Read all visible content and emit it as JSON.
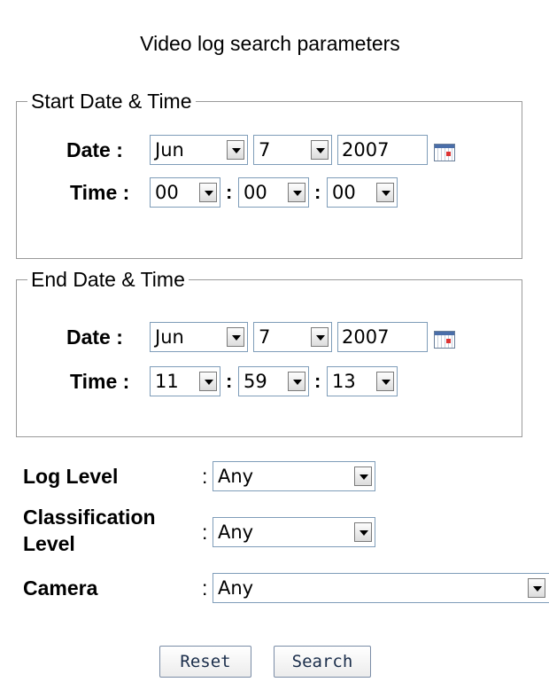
{
  "title": "Video log search parameters",
  "start": {
    "legend": "Start Date & Time",
    "date_label": "Date :",
    "time_label": "Time :",
    "month": "Jun",
    "day": "7",
    "year": "2007",
    "hour": "00",
    "minute": "00",
    "second": "00"
  },
  "end": {
    "legend": "End Date & Time",
    "date_label": "Date :",
    "time_label": "Time :",
    "month": "Jun",
    "day": "7",
    "year": "2007",
    "hour": "11",
    "minute": "59",
    "second": "13"
  },
  "time_separator": ":",
  "filters": {
    "log_level_label": "Log Level",
    "log_level_value": "Any",
    "classification_label_1": "Classification",
    "classification_label_2": "Level",
    "classification_value": "Any",
    "camera_label": "Camera",
    "camera_value": "Any",
    "colon": ":"
  },
  "buttons": {
    "reset": "Reset",
    "search": "Search"
  },
  "icons": {
    "calendar": "calendar-icon"
  }
}
